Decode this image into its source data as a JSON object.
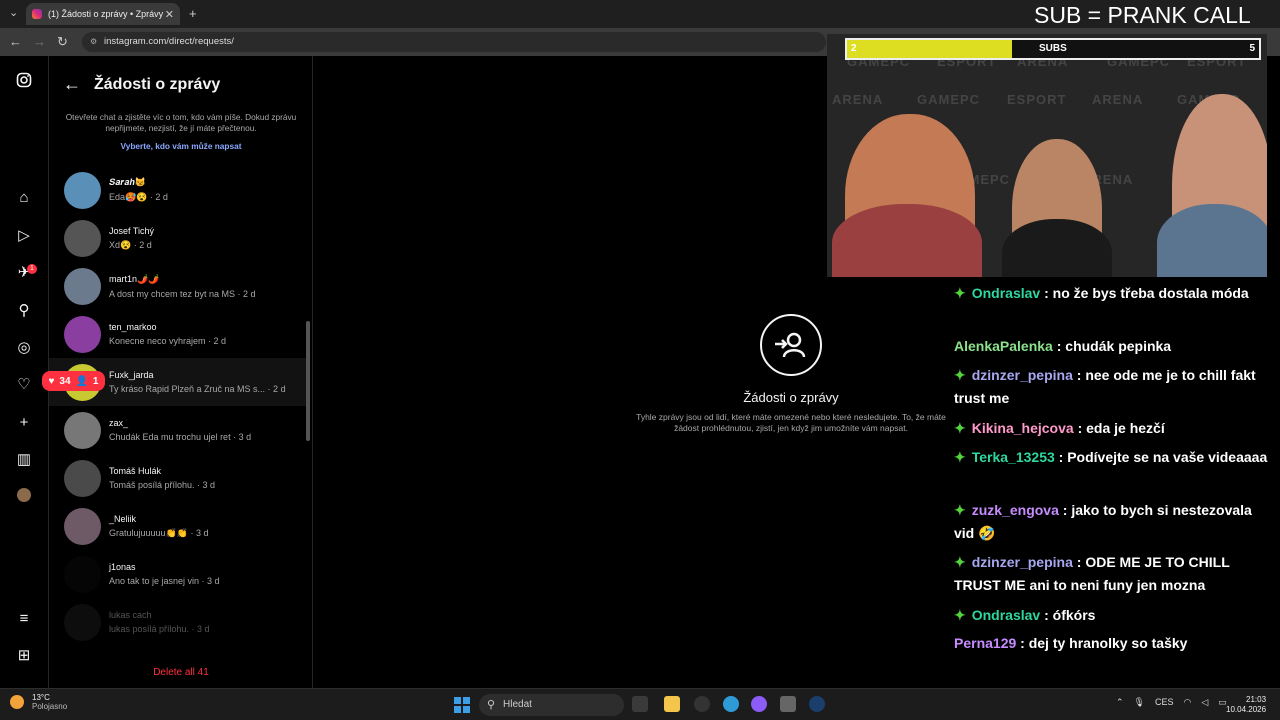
{
  "browser": {
    "tab_title": "(1) Žádosti o zprávy • Zprávy",
    "tab_close": "✕",
    "new_tab": "+",
    "url": "instagram.com/direct/requests/"
  },
  "overlay": {
    "title": "SUB = PRANK CALL",
    "sub_bar_left": "2",
    "sub_bar_label": "SUBS",
    "sub_bar_right": "5",
    "sub_bar_fill": 0.4,
    "banner_texts": [
      "GAMEPC",
      "ESPORT",
      "ARENA"
    ]
  },
  "sidebar": {
    "icons": [
      "instagram-icon",
      "home-icon",
      "reels-icon",
      "messages-icon",
      "search-icon",
      "explore-icon",
      "notifications-icon",
      "create-icon",
      "dashboard-icon",
      "profile-icon",
      "menu-icon",
      "threads-icon"
    ],
    "messages_badge": "1",
    "likes_count": "34",
    "followers_count": "1"
  },
  "panel": {
    "title": "Žádosti o zprávy",
    "description": "Otevřete chat a zjistěte víc o tom, kdo vám píše. Dokud zprávu nepřijmete, nezjistí, že jí máte přečtenou.",
    "link": "Vyberte, kdo vám může napsat",
    "requests": [
      {
        "name": "𝑺𝒂𝒓𝒂𝒉😼",
        "message": "Eda🥵😵 · 2 d",
        "color": "#5a8fb8"
      },
      {
        "name": "Josef Tichý",
        "message": "Xd😵 · 2 d",
        "color": "#555555"
      },
      {
        "name": "mart1n🌶️🌶️",
        "message": "A dost my chcem tez byt na MS · 2 d",
        "color": "#6b7a8c"
      },
      {
        "name": "ten_markoo",
        "message": "Konecne neco vyhrajem · 2 d",
        "color": "#8a3fa0"
      },
      {
        "name": "Fuxk_jarda",
        "message": "Ty kráso Rapid Plzeň a Zruč na MS s... · 2 d",
        "color": "#c8c832"
      },
      {
        "name": "zax_",
        "message": "Chudák Eda mu trochu ujel ret · 3 d",
        "color": "#777777"
      },
      {
        "name": "Tomáš Hulák",
        "message": "Tomáš posílá přílohu. · 3 d",
        "color": "#4a4a4a"
      },
      {
        "name": "_Neliik",
        "message": "Gratulujuuuuu👏👏 · 3 d",
        "color": "#6e5a66"
      },
      {
        "name": "j1onas",
        "message": "Ano tak to je jasnej vin · 3 d",
        "color": "#050505"
      },
      {
        "name": "lukas cach",
        "message": "lukas posílá přílohu. · 3 d",
        "color": "#0d0d0d"
      }
    ],
    "delete_all": "Delete all 41"
  },
  "main": {
    "title": "Žádosti o zprávy",
    "description": "Tyhle zprávy jsou od lidí, které máte omezené nebo které nesledujete. To, že máte žádost prohlédnutou, zjistí, jen když jim umožníte vám napsat."
  },
  "chat": [
    {
      "user": "Ondraslav",
      "text": ": no že bys třeba dostala móda",
      "color": "#2fd6a0",
      "gem": true
    },
    {
      "user": "AlenkaPalenka",
      "text": ": chudák pepinka",
      "color": "#8be28b",
      "gem": false
    },
    {
      "user": "dzinzer_pepina",
      "text": ": nee ode me je to chill fakt trust me",
      "color": "#a7a7f0",
      "gem": true
    },
    {
      "user": "Kikina_hejcova",
      "text": ": eda je hezčí",
      "color": "#ff9acb",
      "gem": true
    },
    {
      "user": "Terka_13253",
      "text": ": Podívejte se na vaše videaaaa",
      "color": "#2fd6a0",
      "gem": true
    },
    {
      "user": "zuzk_engova",
      "text": ": jako to bych si nestezovala vid 🤣",
      "color": "#c68cff",
      "gem": true
    },
    {
      "user": "dzinzer_pepina",
      "text": ": ODE ME JE TO CHILL TRUST ME ani to neni funy jen mozna",
      "color": "#a7a7f0",
      "gem": true
    },
    {
      "user": "Ondraslav",
      "text": ": ófkórs",
      "color": "#2fd6a0",
      "gem": true
    },
    {
      "user": "Perna129",
      "text": ": dej ty hranolky so tašky",
      "color": "#c68cff",
      "gem": false
    }
  ],
  "taskbar": {
    "temperature": "13°C",
    "weather": "Polojasno",
    "search_placeholder": "Hledat",
    "language": "CES",
    "time": "21:03",
    "date": "10.04.2026"
  }
}
